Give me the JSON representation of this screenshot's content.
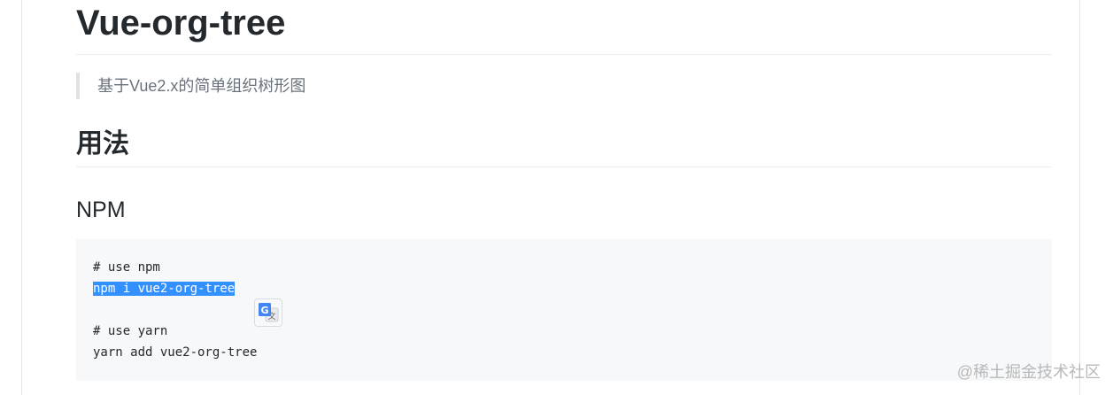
{
  "doc": {
    "title": "Vue-org-tree",
    "quote": "基于Vue2.x的简单组织树形图",
    "section_heading": "用法",
    "subsection_heading": "NPM",
    "code_lines": [
      "# use npm",
      "npm i vue2-org-tree",
      "# use yarn",
      "yarn add vue2-org-tree"
    ]
  },
  "overlay": {
    "translate_icon": "google-translate-icon"
  },
  "watermark": "@稀土掘金技术社区",
  "colors": {
    "selection": "#3390ff",
    "code_bg": "#f6f8fa",
    "text": "#24292e",
    "quote_text": "#6a737d"
  }
}
